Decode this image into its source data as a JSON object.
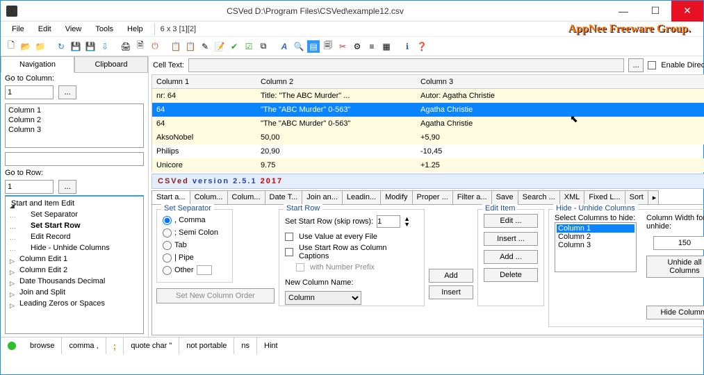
{
  "title": "CSVed D:\\Program Files\\CSVed\\example12.csv",
  "menus": {
    "file": "File",
    "edit": "Edit",
    "view": "View",
    "tools": "Tools",
    "help": "Help",
    "info": "6 x 3 [1][2]"
  },
  "brand": "AppNee Freeware Group.",
  "nav": {
    "tab1": "Navigation",
    "tab2": "Clipboard",
    "gotoCol": "Go to Column:",
    "gotoColVal": "1",
    "gotoRow": "Go to Row:",
    "gotoRowVal": "1",
    "cols": [
      "Column 1",
      "Column 2",
      "Column 3"
    ]
  },
  "tree": {
    "t0": "Start and Item Edit",
    "s0": "Set Separator",
    "s1": "Set Start Row",
    "s2": "Edit Record",
    "s3": "Hide - Unhide Columns",
    "t1": "Column Edit 1",
    "t2": "Column Edit 2",
    "t3": "Date Thousands Decimal",
    "t4": "Join and Split",
    "t5": "Leading Zeros or Spaces"
  },
  "celltext": {
    "label": "Cell Text:",
    "dots": "...",
    "enable": "Enable Direct Editing"
  },
  "grid": {
    "h1": "Column 1",
    "h2": "Column 2",
    "h3": "Column 3",
    "r0c1": "nr: 64",
    "r0c2": "Title: \"The ABC Murder\" ...",
    "r0c3": "Autor: Agatha Christie",
    "r1c1": "64",
    "r1c2": "\"The \"ABC Murder\" 0-563\"",
    "r1c3": "Agatha Christie",
    "r2c1": "64",
    "r2c2": "\"The \"ABC Murder\" 0-563\"",
    "r2c3": "Agatha Christie",
    "r3c1": "AksoNobel",
    "r3c2": "50,00",
    "r3c3": "+5,90",
    "r4c1": "Philips",
    "r4c2": "20,90",
    "r4c3": "-10,45",
    "r5c1": "Unicore",
    "r5c2": "9.75",
    "r5c3": "+1.25"
  },
  "version": {
    "a": "CSVed ",
    "b": "version 2.5.1 ",
    "c": "2017"
  },
  "tabs": [
    "Start a...",
    "Colum...",
    "Colum...",
    "Date T...",
    "Join an...",
    "Leadin...",
    "Modify",
    "Proper ...",
    "Filter a...",
    "Save",
    "Search ...",
    "XML",
    "Fixed L...",
    "Sort"
  ],
  "sep": {
    "title": "Set Separator",
    "comma": ", Comma",
    "semi": "; Semi Colon",
    "tab": "Tab",
    "pipe": "| Pipe",
    "other": "Other"
  },
  "startrow": {
    "title": "Start Row",
    "label": "Set Start Row (skip rows):",
    "val": "1",
    "chk1": "Use Value at every File",
    "chk2": "Use Start Row as Column Captions",
    "chk3": "with Number Prefix",
    "newcol": "New Column Name:",
    "combo": "Column",
    "add": "Add",
    "insert": "Insert"
  },
  "edititem": {
    "title": "Edit Item",
    "edit": "Edit ...",
    "insert": "Insert ...",
    "add": "Add ...",
    "delete": "Delete"
  },
  "hide": {
    "title": "Hide - Unhide Columns",
    "sel": "Select Columns to hide:",
    "c1": "Column 1",
    "c2": "Column 2",
    "c3": "Column 3",
    "width": "Column Width for unhide:",
    "widthval": "150",
    "unhide": "Unhide all Columns",
    "hidebtn": "Hide Columns"
  },
  "setorder": "Set New Column Order",
  "status": {
    "browse": "browse",
    "comma": "comma ,",
    "semi": ";",
    "quote": "quote char \"",
    "portable": "not portable",
    "ns": "ns",
    "hint": "Hint"
  }
}
